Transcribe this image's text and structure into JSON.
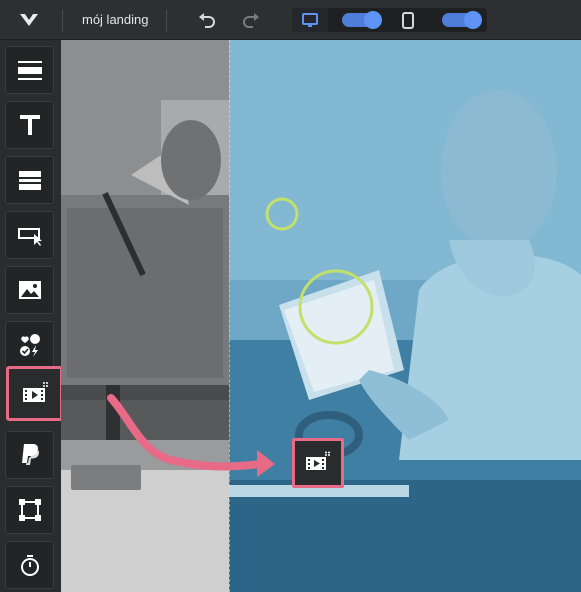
{
  "header": {
    "title": "mój landing",
    "icons": {
      "logo": "logo-icon",
      "undo": "undo-icon",
      "redo": "redo-icon",
      "desktop": "desktop-icon",
      "mobile": "mobile-icon"
    },
    "desktop_toggle_on": true,
    "mobile_toggle_on": true
  },
  "sidebar": {
    "items": [
      {
        "name": "section",
        "icon": "section-layout-icon"
      },
      {
        "name": "text",
        "icon": "text-icon"
      },
      {
        "name": "box",
        "icon": "box-icon"
      },
      {
        "name": "button",
        "icon": "button-icon"
      },
      {
        "name": "image",
        "icon": "image-icon"
      },
      {
        "name": "icons",
        "icon": "icons-icon"
      },
      {
        "name": "video",
        "icon": "video-icon",
        "active": true
      },
      {
        "name": "paypal",
        "icon": "paypal-icon"
      },
      {
        "name": "shape",
        "icon": "shape-icon"
      },
      {
        "name": "timer",
        "icon": "timer-icon"
      }
    ]
  },
  "colors": {
    "accent": "#e76a86",
    "toggle": "#5f93f3",
    "highlight_circle": "#c3e06a",
    "photo_tint": "#6aa6c6"
  }
}
